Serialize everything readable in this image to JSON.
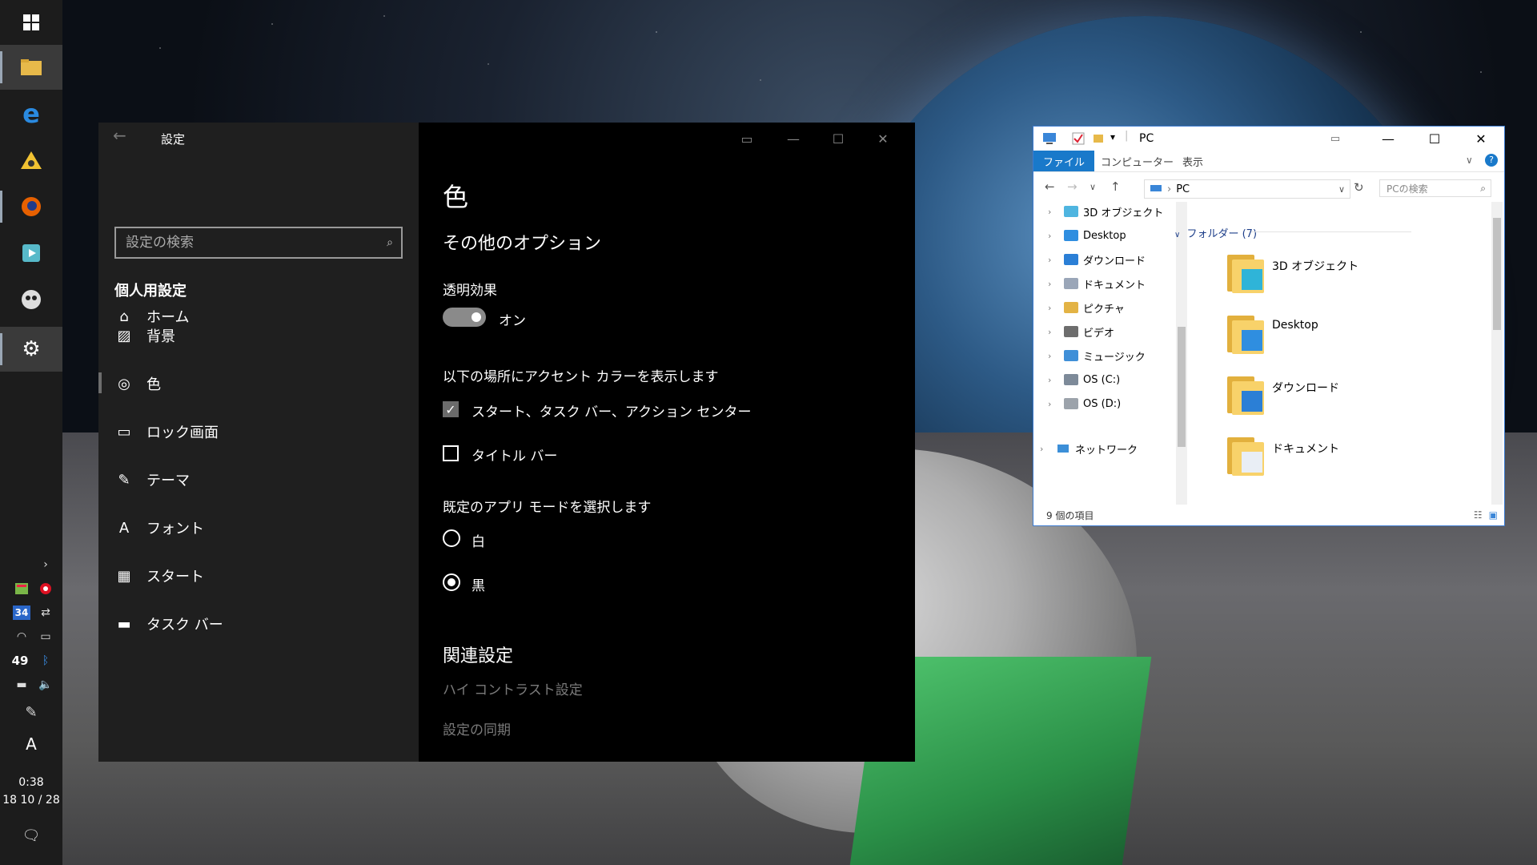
{
  "taskbar": {
    "clock_time": "0:38",
    "clock_date": "18  10 / 28",
    "tray_number": "34",
    "tray_weather": "49",
    "ime": "A"
  },
  "settings": {
    "window_title": "設定",
    "home_label": "ホーム",
    "search_placeholder": "設定の検索",
    "section_title": "個人用設定",
    "nav": [
      {
        "label": "背景"
      },
      {
        "label": "色"
      },
      {
        "label": "ロック画面"
      },
      {
        "label": "テーマ"
      },
      {
        "label": "フォント"
      },
      {
        "label": "スタート"
      },
      {
        "label": "タスク バー"
      }
    ],
    "page_title": "色",
    "more_options": "その他のオプション",
    "transparency_label": "透明効果",
    "transparency_state": "オン",
    "accent_label": "以下の場所にアクセント カラーを表示します",
    "accent_start": "スタート、タスク バー、アクション センター",
    "accent_titlebar": "タイトル バー",
    "mode_label": "既定のアプリ モードを選択します",
    "mode_light": "白",
    "mode_dark": "黒",
    "related_title": "関連設定",
    "related_links": [
      "ハイ コントラスト設定",
      "設定の同期"
    ]
  },
  "explorer": {
    "title": "PC",
    "ribbon_tabs": [
      "ファイル",
      "コンピューター",
      "表示"
    ],
    "address": "PC",
    "search_placeholder": "PCの検索",
    "tree": [
      {
        "label": "3D オブジェクト",
        "color": "#4fb5e0"
      },
      {
        "label": "Desktop",
        "color": "#2f8ee0"
      },
      {
        "label": "ダウンロード",
        "color": "#2b7fd6"
      },
      {
        "label": "ドキュメント",
        "color": "#9aa6b8"
      },
      {
        "label": "ピクチャ",
        "color": "#e3b345"
      },
      {
        "label": "ビデオ",
        "color": "#6d6d6d"
      },
      {
        "label": "ミュージック",
        "color": "#3f8fd8"
      },
      {
        "label": "OS (C:)",
        "color": "#7d8a99"
      },
      {
        "label": "OS (D:)",
        "color": "#9ca3ab"
      }
    ],
    "network": "ネットワーク",
    "group_header": "フォルダー (7)",
    "items": [
      {
        "label": "3D オブジェクト"
      },
      {
        "label": "Desktop"
      },
      {
        "label": "ダウンロード"
      },
      {
        "label": "ドキュメント"
      }
    ],
    "status": "9 個の項目"
  }
}
